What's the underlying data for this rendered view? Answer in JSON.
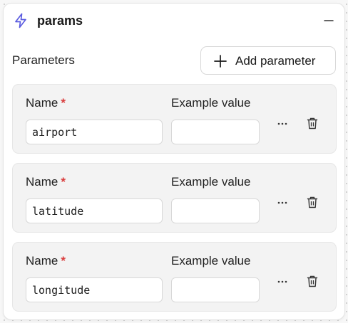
{
  "node": {
    "title": "params",
    "icon": "bolt-icon",
    "accent_color": "#5b5ce0"
  },
  "parameters": {
    "section_label": "Parameters",
    "add_button_label": "Add parameter",
    "name_label": "Name",
    "required_marker": "*",
    "example_label": "Example value",
    "items": [
      {
        "name": "airport",
        "example_value": ""
      },
      {
        "name": "latitude",
        "example_value": ""
      },
      {
        "name": "longitude",
        "example_value": ""
      }
    ]
  },
  "colors": {
    "required": "#d93b3b"
  }
}
